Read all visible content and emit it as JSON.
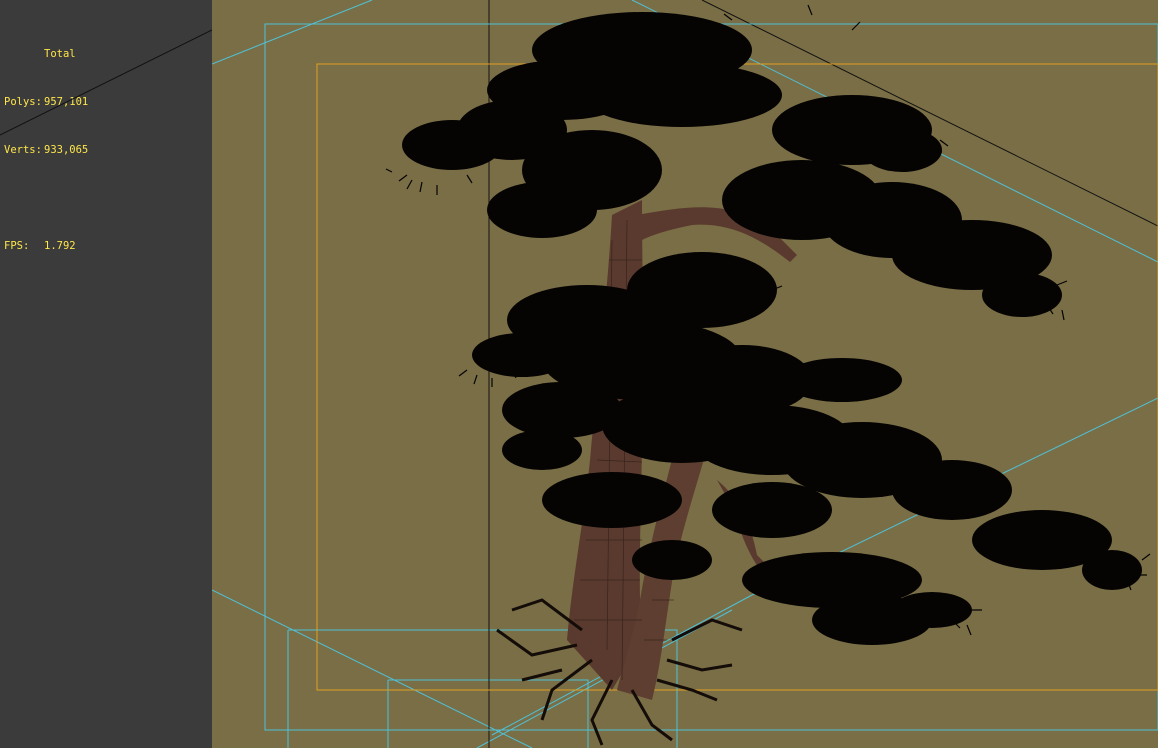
{
  "stats": {
    "header": "Total",
    "polys_label": "Polys:",
    "polys_value": "957,101",
    "verts_label": "Verts:",
    "verts_value": "933,065",
    "fps_label": "FPS:",
    "fps_value": "1.792"
  },
  "colors": {
    "viewport_bg": "#7a6e46",
    "panel_bg": "#3b3b3b",
    "stats_text": "#ffe64a",
    "safe_frame_outer": "#4fc1d8",
    "safe_frame_inner": "#e0a020",
    "tree_silhouette": "#050403",
    "trunk": "#5a3a2e"
  },
  "scene": {
    "object": "pine-tree-model",
    "render_mode": "wireframe-over-shaded"
  }
}
